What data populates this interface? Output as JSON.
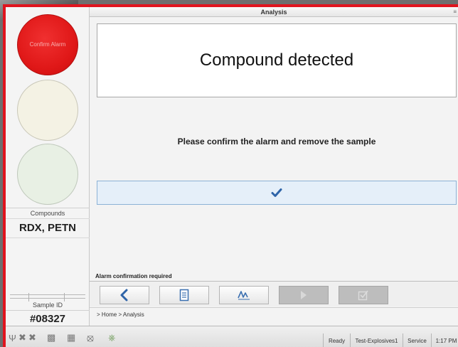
{
  "window": {
    "title": "Analysis",
    "menu_icon": "menu-icon"
  },
  "lamps": [
    {
      "name": "red-alarm-lamp",
      "label": "Confirm Alarm",
      "color": "#e01818"
    },
    {
      "name": "yellow-lamp",
      "label": "",
      "color": "#f4f2e4"
    },
    {
      "name": "green-lamp",
      "label": "",
      "color": "#e8f0e4"
    }
  ],
  "left_panel": {
    "compounds_label": "Compounds",
    "compounds_value": "RDX, PETN",
    "sample_id_label": "Sample ID",
    "sample_id_value": "#08327"
  },
  "main": {
    "banner_text": "Compound detected",
    "message": "Please confirm the alarm and remove the sample",
    "confirm_icon": "checkmark-icon",
    "status_message": "Alarm confirmation required"
  },
  "toolbar": {
    "buttons": [
      {
        "name": "back-button",
        "icon": "chevron-left-icon",
        "enabled": true
      },
      {
        "name": "report-button",
        "icon": "document-icon",
        "enabled": true
      },
      {
        "name": "signature-button",
        "icon": "signature-icon",
        "enabled": true
      },
      {
        "name": "play-button",
        "icon": "play-icon",
        "enabled": false
      },
      {
        "name": "checklist-button",
        "icon": "checklist-icon",
        "enabled": false
      }
    ]
  },
  "breadcrumb": "> Home > Analysis",
  "status_bar": {
    "icons": [
      "usb-icon",
      "disconnected-icon",
      "disconnected-icon",
      "network-icon",
      "keyboard-icon",
      "close-circle-icon",
      "plug-icon"
    ],
    "cells": [
      "Ready",
      "Test-Explosives1",
      "Service",
      "1:17 PM"
    ]
  },
  "colors": {
    "accent": "#e0141e",
    "confirm_blue": "#2e64a8",
    "confirm_bg": "#e5eff9"
  }
}
